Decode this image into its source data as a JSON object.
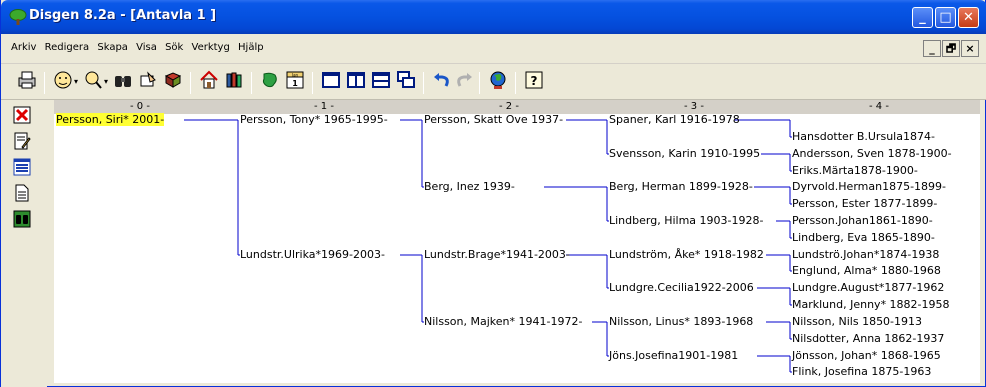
{
  "window": {
    "title": "Disgen 8.2a - [Antavla 1 ]"
  },
  "title_buttons": {
    "minimize": "_",
    "maximize": "□",
    "close": "✕"
  },
  "menu": [
    "Arkiv",
    "Redigera",
    "Skapa",
    "Visa",
    "Sök",
    "Verktyg",
    "Hjälp"
  ],
  "mdi_buttons": {
    "minimize": "_",
    "restore": "🗗",
    "close": "×"
  },
  "toolbar_icons": [
    "print-icon",
    "person-icon",
    "person-search-icon",
    "binoculars-icon",
    "hand-icon",
    "book-icon",
    "home-icon",
    "books-icon",
    "map-icon",
    "calendar-icon",
    "single-pane-icon",
    "two-pane-icon",
    "horizontal-pane-icon",
    "cascade-icon",
    "undo-icon",
    "redo-icon",
    "globe-icon",
    "help-icon"
  ],
  "calendar_label": "Jan\n1",
  "help_label": "?",
  "left_icons": [
    "delete-icon",
    "edit-icon",
    "list-icon",
    "document-icon",
    "binoculars-icon"
  ],
  "generation_headers": [
    "- 0 -",
    "- 1 -",
    "- 2 -",
    "- 3 -",
    "- 4 -"
  ],
  "highlight_color": "#ffff33",
  "line_color": "#0000cc",
  "people": [
    "Persson, Siri* 2001-",
    "Persson, Tony* 1965-1995-",
    "Lundstr.Ulrika*1969-2003-",
    "Persson, Skatt Ove 1937-",
    "Berg, Inez 1939-",
    "Lundstr.Brage*1941-2003-",
    "Nilsson, Majken* 1941-1972-",
    "Spaner, Karl 1916-1978",
    "Svensson, Karin 1910-1995",
    "Berg, Herman 1899-1928-",
    "Lindberg, Hilma 1903-1928-",
    "Lundström, Åke* 1918-1982",
    "Lundgre.Cecilia1922-2006",
    "Nilsson, Linus* 1893-1968",
    "Jöns.Josefina1901-1981",
    "Hansdotter B.Ursula1874-",
    "Andersson, Sven 1878-1900-",
    "Eriks.Märta1878-1900-",
    "Dyrvold.Herman1875-1899-",
    "Persson, Ester 1877-1899-",
    "Persson.Johan1861-1890-",
    "Lindberg, Eva 1865-1890-",
    "Lundströ.Johan*1874-1938",
    "Englund, Alma* 1880-1968",
    "Lundgre.August*1877-1962",
    "Marklund, Jenny* 1882-1958",
    "Nilsson, Nils 1850-1913",
    "Nilsdotter, Anna 1862-1937",
    "Jönsson, Johan* 1868-1965",
    "Flink, Josefina 1875-1963"
  ]
}
